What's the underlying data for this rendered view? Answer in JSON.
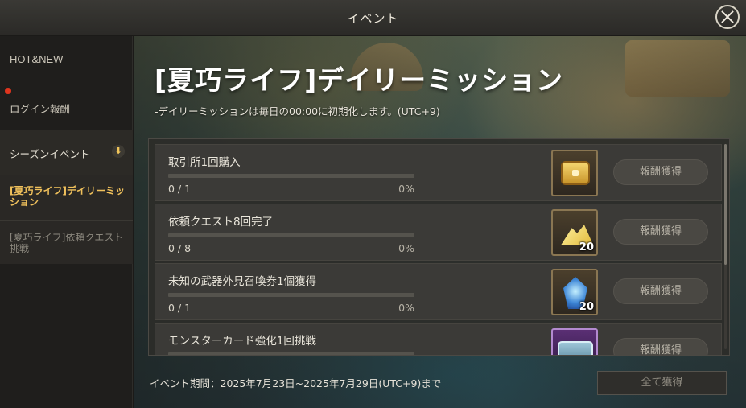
{
  "window": {
    "title": "イベント"
  },
  "sidebar": {
    "items": [
      {
        "label": "HOT&NEW"
      },
      {
        "label": "ログイン報酬",
        "badge": "red-dot"
      },
      {
        "label": "シーズンイベント",
        "icon": "chevron-down-icon"
      }
    ],
    "sub_items": [
      {
        "label": "[夏巧ライフ]デイリーミッション",
        "selected": true
      },
      {
        "label": "[夏巧ライフ]依頼クエスト挑戦",
        "selected": false
      }
    ]
  },
  "event": {
    "title": "[夏巧ライフ]デイリーミッション",
    "subtitle": "-デイリーミッションは毎日の00:00に初期化します。(UTC+9)"
  },
  "missions": [
    {
      "label": "取引所1回購入",
      "count": "0 / 1",
      "percent": "0%",
      "progress": 0,
      "reward_icon": "gold-chest-icon",
      "reward_qty": "",
      "claim_label": "報酬獲得"
    },
    {
      "label": "依頼クエスト8回完了",
      "count": "0 / 8",
      "percent": "0%",
      "progress": 0,
      "reward_icon": "gold-crystal-icon",
      "reward_qty": "20",
      "claim_label": "報酬獲得"
    },
    {
      "label": "未知の武器外見召喚券1個獲得",
      "count": "0 / 1",
      "percent": "0%",
      "progress": 0,
      "reward_icon": "blue-gem-icon",
      "reward_qty": "20",
      "claim_label": "報酬獲得"
    },
    {
      "label": "モンスターカード強化1回挑戦",
      "count": "",
      "percent": "",
      "progress": 0,
      "reward_icon": "chest-box-icon",
      "reward_qty": "",
      "claim_label": "報酬獲得"
    }
  ],
  "footer": {
    "period": "イベント期間：2025年7月23日~2025年7月29日(UTC+9)まで",
    "claim_all_label": "全て獲得"
  },
  "colors": {
    "accent_gold": "#f0c15c",
    "badge_red": "#e0351e",
    "progress_fill": "#d8a848"
  }
}
